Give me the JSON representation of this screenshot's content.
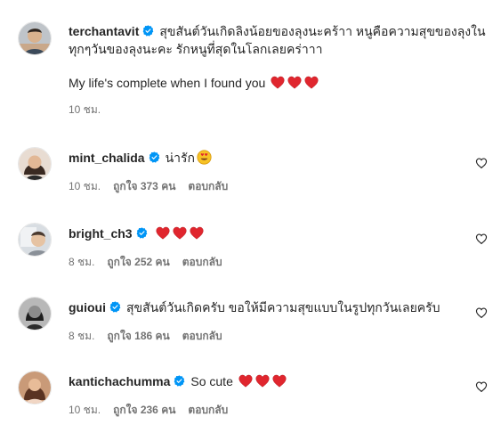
{
  "post": {
    "username": "terchantavit",
    "caption_th": "สุขสันต์วันเกิดลิงน้อยของลุงนะคร้าา หนูคือความสุขของลุงในทุกๆวันของลุงนะคะ รักหนูที่สุดในโลกเลยคร่าาา",
    "caption_en": "My life's complete when I found you",
    "time": "10 ชม."
  },
  "comments": [
    {
      "username": "mint_chalida",
      "text": "น่ารัก",
      "time": "10 ชม.",
      "likes": "ถูกใจ 373 คน",
      "reply": "ตอบกลับ"
    },
    {
      "username": "bright_ch3",
      "text": "",
      "time": "8 ชม.",
      "likes": "ถูกใจ 252 คน",
      "reply": "ตอบกลับ"
    },
    {
      "username": "guioui",
      "text": "สุขสันต์วันเกิดครับ ขอให้มีความสุขแบบในรูปทุกวันเลยครับ",
      "time": "8 ชม.",
      "likes": "ถูกใจ 186 คน",
      "reply": "ตอบกลับ"
    },
    {
      "username": "kantichachumma",
      "text": "So cute",
      "time": "10 ชม.",
      "likes": "ถูกใจ 236 คน",
      "reply": "ตอบกลับ"
    }
  ],
  "icons": {
    "verified": "verified-badge-icon",
    "heart_emoji": "red-heart-emoji-icon",
    "heart_eyes": "heart-eyes-emoji-icon",
    "like": "heart-outline-icon"
  },
  "colors": {
    "verified": "#0095f6",
    "heart": "#e0262e",
    "muted": "#737373"
  }
}
